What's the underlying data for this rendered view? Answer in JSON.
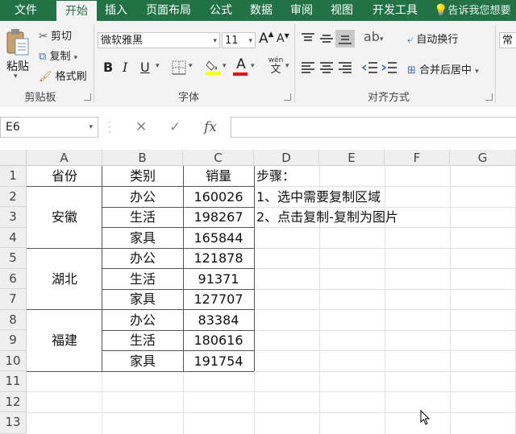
{
  "ribbon_tabs": [
    "文件",
    "开始",
    "插入",
    "页面布局",
    "公式",
    "数据",
    "审阅",
    "视图",
    "开发工具"
  ],
  "tell_me": "告诉我您想要",
  "clipboard": {
    "paste": "粘贴",
    "cut": "剪切",
    "copy": "复制",
    "format_painter": "格式刷",
    "group_label": "剪贴板"
  },
  "font": {
    "name": "微软雅黑",
    "size": "11",
    "group_label": "字体",
    "bold": "B",
    "italic": "I",
    "underline": "U",
    "grow": "A",
    "shrink": "A",
    "phonetic_top": "wén",
    "phonetic_bottom": "文",
    "highlight_color": "#ffff00",
    "font_color": "#ff0000"
  },
  "alignment": {
    "wrap_text": "自动换行",
    "merge_center": "合并后居中",
    "group_label": "对齐方式"
  },
  "number": {
    "format": "常规"
  },
  "formula_bar": {
    "name_box": "E6",
    "cancel": "✕",
    "enter": "✓",
    "fx": "fx",
    "content": ""
  },
  "columns": [
    "A",
    "B",
    "C",
    "D",
    "E",
    "F",
    "G"
  ],
  "rows": [
    "1",
    "2",
    "3",
    "4",
    "5",
    "6",
    "7",
    "8",
    "9",
    "10",
    "11",
    "12",
    "13"
  ],
  "table": {
    "headers": [
      "省份",
      "类别",
      "销量"
    ],
    "provinces": [
      "安徽",
      "湖北",
      "福建"
    ],
    "rows": [
      [
        "办公",
        "160026"
      ],
      [
        "生活",
        "198267"
      ],
      [
        "家具",
        "165844"
      ],
      [
        "办公",
        "121878"
      ],
      [
        "生活",
        "91371"
      ],
      [
        "家具",
        "127707"
      ],
      [
        "办公",
        "83384"
      ],
      [
        "生活",
        "180616"
      ],
      [
        "家具",
        "191754"
      ]
    ]
  },
  "notes": [
    "步骤：",
    "1、选中需要复制区域",
    "2、点击复制-复制为图片"
  ],
  "colors": {
    "accent": "#217346"
  }
}
